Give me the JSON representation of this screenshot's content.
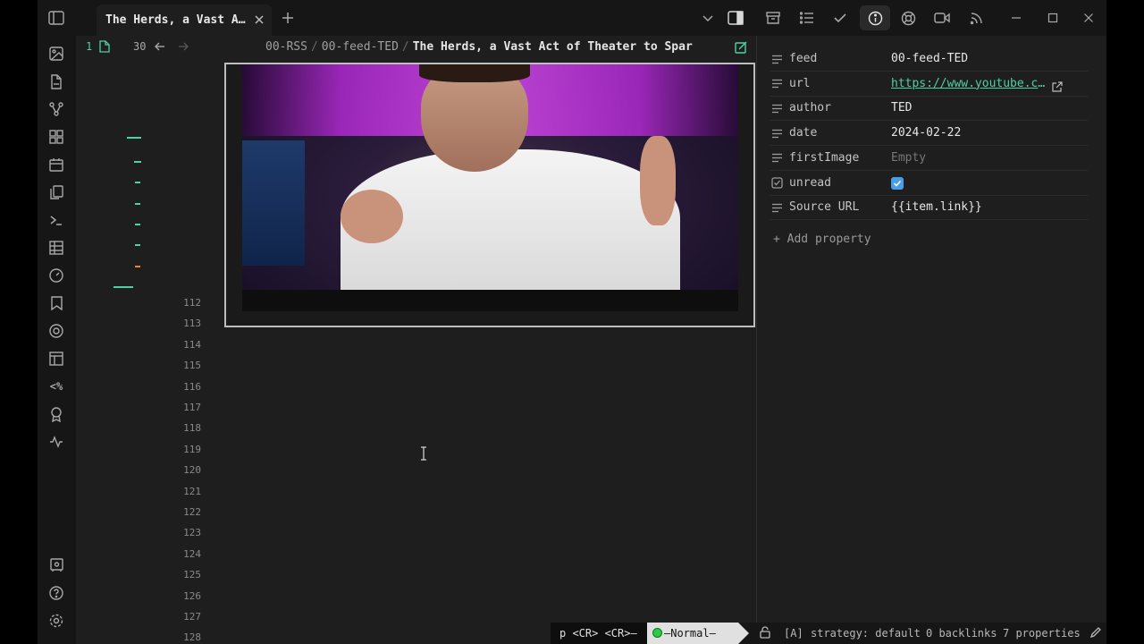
{
  "tab": {
    "title": "The Herds, a Vast Act of Theater to Spark Climate Action"
  },
  "nav": {
    "pane_number": "1",
    "history_count": "30"
  },
  "breadcrumb": {
    "folder": "00-RSS",
    "subfolder": "00-feed-TED",
    "current": "The Herds, a Vast Act of Theater to Spar"
  },
  "line_numbers": [
    "112",
    "113",
    "114",
    "115",
    "116",
    "117",
    "118",
    "119",
    "120",
    "121",
    "122",
    "123",
    "124",
    "125",
    "126",
    "127",
    "128"
  ],
  "properties": [
    {
      "icon": "list-icon",
      "key": "feed",
      "value": "00-feed-TED"
    },
    {
      "icon": "list-icon",
      "key": "url",
      "value": "https://www.youtube.com/watch"
    },
    {
      "icon": "list-icon",
      "key": "author",
      "value": "TED"
    },
    {
      "icon": "list-icon",
      "key": "date",
      "value": "2024-02-22"
    },
    {
      "icon": "list-icon",
      "key": "firstImage",
      "value": "Empty"
    },
    {
      "icon": "checkbox-icon",
      "key": "unread",
      "value": ""
    },
    {
      "icon": "list-icon",
      "key": "Source URL",
      "value": "{{item.link}}"
    }
  ],
  "add_property_label": "Add property",
  "status": {
    "keys": "p <CR> <CR>–",
    "mode": "–Normal–",
    "vault_flag": "[A]",
    "strategy": "strategy: default",
    "backlinks": "0 backlinks",
    "properties_count": "7 properties"
  },
  "colors": {
    "accent": "#4fd1a5",
    "checkbox": "#4a9ee8",
    "mode_indicator": "#2ec84a",
    "gutter_orange": "#e08a2a"
  },
  "ribbon_icons": [
    "image-icon",
    "file-icon",
    "graph-icon",
    "blocks-icon",
    "calendar-icon",
    "copy-icon",
    "terminal-icon",
    "table-icon",
    "gauge-icon",
    "bookmark-icon",
    "lifebuoy-icon",
    "layout-icon",
    "template-icon",
    "award-icon",
    "activity-icon",
    "vault-icon",
    "help-icon",
    "settings-icon"
  ]
}
